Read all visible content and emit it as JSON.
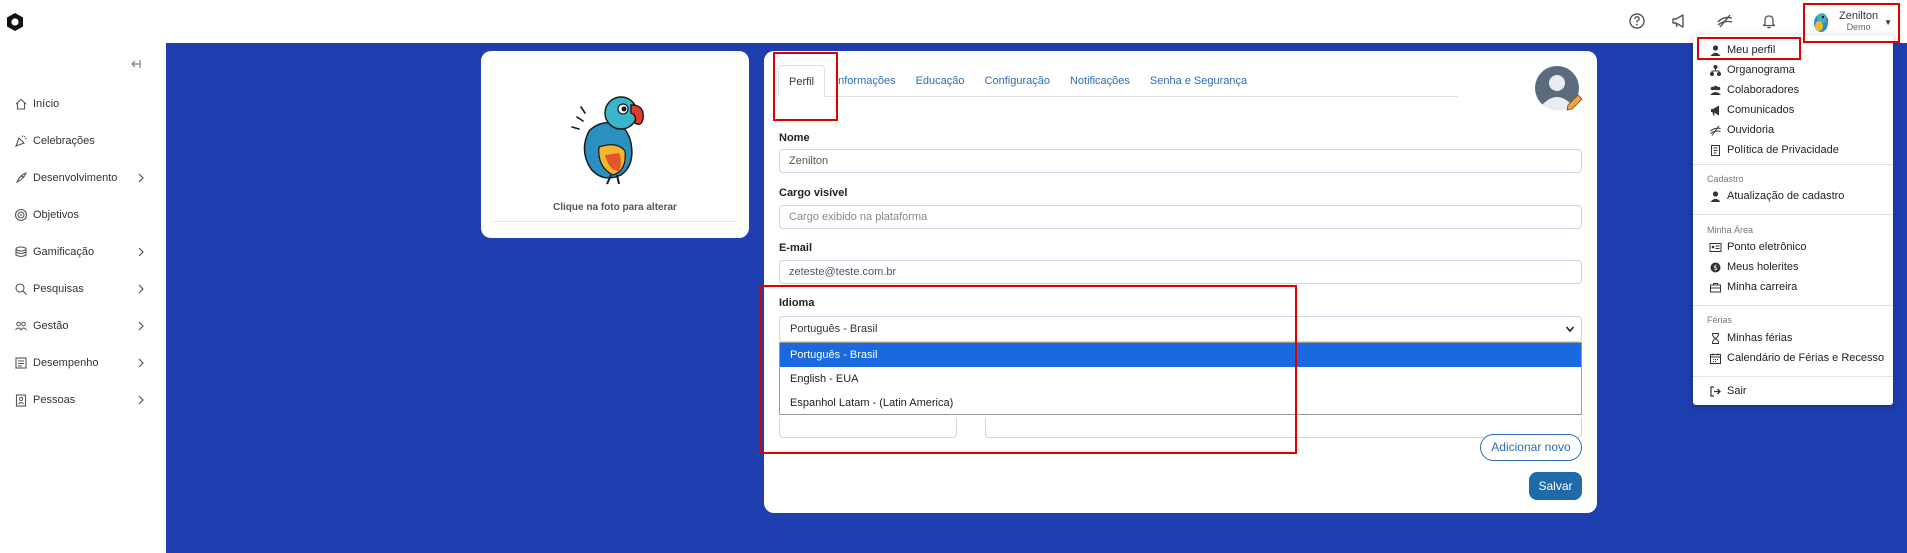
{
  "topbar": {
    "user_name": "Zenilton",
    "user_role": "Demo",
    "icons": [
      "help-icon",
      "megaphone-icon",
      "ombudsman-icon",
      "bell-icon"
    ]
  },
  "sidebar": {
    "items": [
      {
        "label": "Início",
        "icon": "home-icon",
        "has_children": false
      },
      {
        "label": "Celebrações",
        "icon": "party-icon",
        "has_children": false
      },
      {
        "label": "Desenvolvimento",
        "icon": "rocket-icon",
        "has_children": true
      },
      {
        "label": "Objetivos",
        "icon": "target-icon",
        "has_children": false
      },
      {
        "label": "Gamificação",
        "icon": "coins-icon",
        "has_children": true
      },
      {
        "label": "Pesquisas",
        "icon": "search-icon",
        "has_children": true
      },
      {
        "label": "Gestão",
        "icon": "people-icon",
        "has_children": true
      },
      {
        "label": "Desempenho",
        "icon": "scorecard-icon",
        "has_children": true
      },
      {
        "label": "Pessoas",
        "icon": "badge-icon",
        "has_children": true
      }
    ]
  },
  "photo_card": {
    "caption": "Clique na foto para alterar"
  },
  "profile": {
    "tabs": [
      {
        "label": "Perfil",
        "active": true
      },
      {
        "label": "Informações",
        "active": false
      },
      {
        "label": "Educação",
        "active": false
      },
      {
        "label": "Configuração",
        "active": false
      },
      {
        "label": "Notificações",
        "active": false
      },
      {
        "label": "Senha e Segurança",
        "active": false
      }
    ],
    "fields": {
      "nome_label": "Nome",
      "nome_value": "Zenilton",
      "cargo_label": "Cargo visível",
      "cargo_placeholder": "Cargo exibido na plataforma",
      "email_label": "E-mail",
      "email_value": "zeteste@teste.com.br",
      "idioma_label": "Idioma",
      "idioma_value": "Português - Brasil"
    },
    "idioma_options": [
      {
        "label": "Português - Brasil",
        "selected": true
      },
      {
        "label": "English - EUA",
        "selected": false
      },
      {
        "label": "Espanhol Latam - (Latin America)",
        "selected": false
      }
    ],
    "add_button": "Adicionar novo",
    "save_button": "Salvar"
  },
  "user_menu": {
    "main_items": [
      {
        "label": "Meu perfil",
        "icon": "user-icon"
      },
      {
        "label": "Organograma",
        "icon": "org-chart-icon"
      },
      {
        "label": "Colaboradores",
        "icon": "users-icon"
      },
      {
        "label": "Comunicados",
        "icon": "megaphone-icon"
      },
      {
        "label": "Ouvidoria",
        "icon": "ombudsman-icon"
      },
      {
        "label": "Política de Privacidade",
        "icon": "document-icon"
      }
    ],
    "cadastro_title": "Cadastro",
    "cadastro_items": [
      {
        "label": "Atualização de cadastro",
        "icon": "user-icon"
      }
    ],
    "minha_area_title": "Minha Área",
    "minha_area_items": [
      {
        "label": "Ponto eletrônico",
        "icon": "id-card-icon"
      },
      {
        "label": "Meus holerites",
        "icon": "money-icon"
      },
      {
        "label": "Minha carreira",
        "icon": "briefcase-icon"
      }
    ],
    "ferias_title": "Férias",
    "ferias_items": [
      {
        "label": "Minhas férias",
        "icon": "hourglass-icon"
      },
      {
        "label": "Calendário de Férias e Recesso",
        "icon": "calendar-icon"
      }
    ],
    "sair": {
      "label": "Sair",
      "icon": "logout-icon"
    }
  },
  "colors": {
    "main_bg": "#1f3fb0",
    "link": "#2d6db5",
    "highlight": "#e00000",
    "dropdown_selected": "#1a6adf",
    "save": "#1f6aa8"
  }
}
